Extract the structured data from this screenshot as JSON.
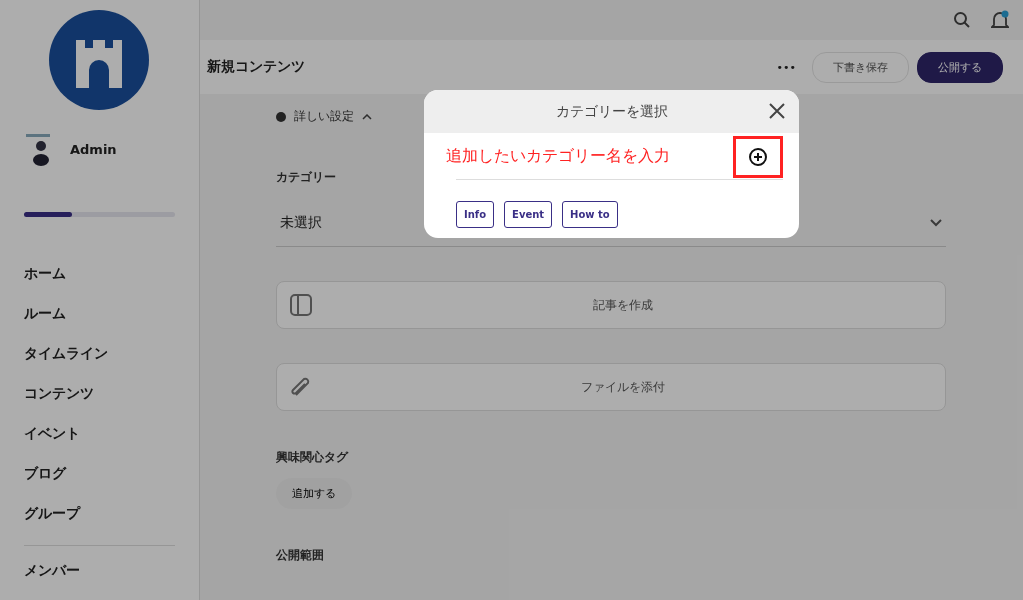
{
  "sidebar": {
    "user": {
      "name": "Admin"
    },
    "guide": {
      "level": 0.32
    },
    "items": [
      {
        "label": "ホーム"
      },
      {
        "label": "ルーム"
      },
      {
        "label": "タイムライン"
      },
      {
        "label": "コンテンツ"
      },
      {
        "label": "イベント"
      },
      {
        "label": "ブログ"
      },
      {
        "label": "グループ"
      }
    ],
    "footer_items": [
      {
        "label": "メンバー"
      }
    ]
  },
  "header": {
    "title": "新規コンテンツ",
    "more": "•••",
    "buttons": [
      {
        "label": "下書き保存",
        "kind": "secondary"
      },
      {
        "label": "公開する",
        "kind": "primary"
      }
    ]
  },
  "form": {
    "advanced": "詳しい設定",
    "category_label": "カテゴリー",
    "category_value": "未選択",
    "actions": [
      "記事を作成",
      "ファイルを添付"
    ],
    "tags_label": "興味関心タグ",
    "tags_button": "追加する",
    "visibility_label": "公開範囲"
  },
  "dialog": {
    "title": "カテゴリーを選択",
    "annotation": "追加したいカテゴリー名を入力",
    "chips": [
      "Info",
      "Event",
      "How to"
    ]
  }
}
